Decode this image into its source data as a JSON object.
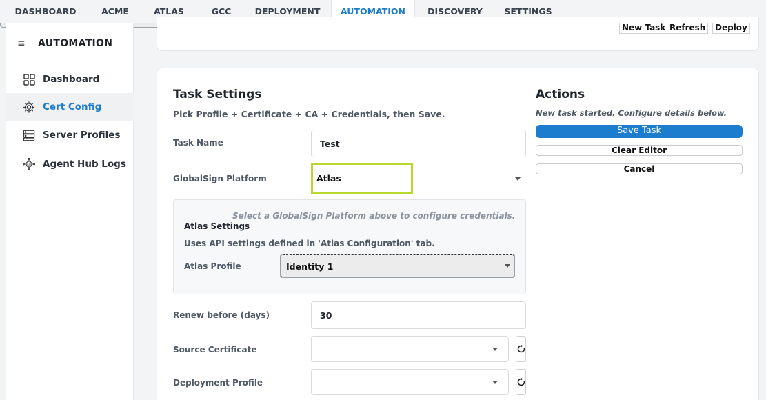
{
  "tabs": [
    {
      "label": "DASHBOARD"
    },
    {
      "label": "ACME"
    },
    {
      "label": "ATLAS"
    },
    {
      "label": "GCC"
    },
    {
      "label": "DEPLOYMENT"
    },
    {
      "label": "AUTOMATION",
      "active": true
    },
    {
      "label": "DISCOVERY"
    },
    {
      "label": "SETTINGS"
    }
  ],
  "sidebar": {
    "title": "AUTOMATION",
    "items": [
      {
        "label": "Dashboard",
        "icon": "dashboard-grid-icon"
      },
      {
        "label": "Cert Config",
        "icon": "gear-icon",
        "active": true
      },
      {
        "label": "Server Profiles",
        "icon": "server-icon"
      },
      {
        "label": "Agent Hub Logs",
        "icon": "api-network-icon"
      }
    ]
  },
  "toolbar": {
    "new_task": "New Task",
    "refresh": "Refresh",
    "deploy": "Deploy"
  },
  "task_settings": {
    "title": "Task Settings",
    "subtitle": "Pick Profile + Certificate + CA + Credentials, then Save.",
    "task_name_label": "Task Name",
    "task_name_value": "Test",
    "platform_label": "GlobalSign Platform",
    "platform_value": "Atlas",
    "credentials_hint": "Select a GlobalSign Platform above to configure credentials.",
    "atlas_settings_title": "Atlas Settings",
    "atlas_settings_desc": "Uses API settings defined in 'Atlas Configuration' tab.",
    "atlas_profile_label": "Atlas Profile",
    "atlas_profile_value": "Identity 1",
    "renew_label": "Renew before (days)",
    "renew_value": "30",
    "source_cert_label": "Source Certificate",
    "source_cert_value": "",
    "deploy_profile_label": "Deployment Profile",
    "deploy_profile_value": ""
  },
  "actions": {
    "title": "Actions",
    "status": "New task started. Configure details below.",
    "save": "Save Task",
    "clear": "Clear Editor",
    "cancel": "Cancel"
  },
  "colors": {
    "accent": "#1c7ccd",
    "highlight": "#b7d92c"
  }
}
